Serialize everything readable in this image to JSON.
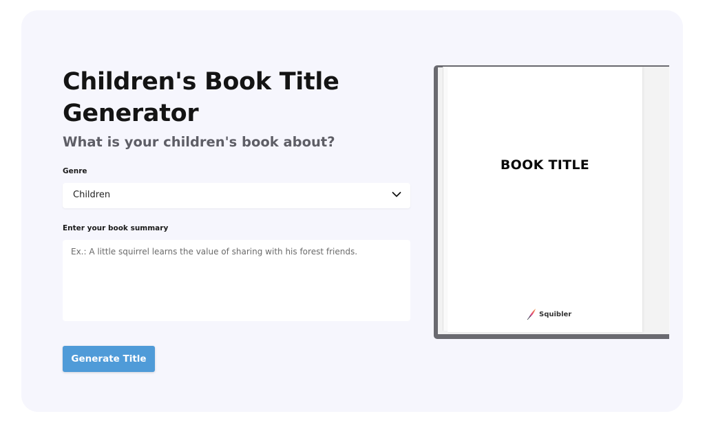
{
  "header": {
    "title": "Children's Book Title Generator",
    "subtitle": "What is your children's book about?"
  },
  "form": {
    "genre_label": "Genre",
    "genre_value": "Children",
    "summary_label": "Enter your book summary",
    "summary_placeholder": "Ex.: A little squirrel learns the value of sharing with his forest friends."
  },
  "button": {
    "label": "Generate Title"
  },
  "preview": {
    "book_title": "BOOK TITLE",
    "brand": "Squibler"
  },
  "icons": [
    "chevron-down-icon",
    "quill-icon"
  ],
  "colors": {
    "accent": "#4f9bd8",
    "card_bg": "#f6f6fd",
    "title": "#141414",
    "subtitle": "#5e5e66"
  }
}
